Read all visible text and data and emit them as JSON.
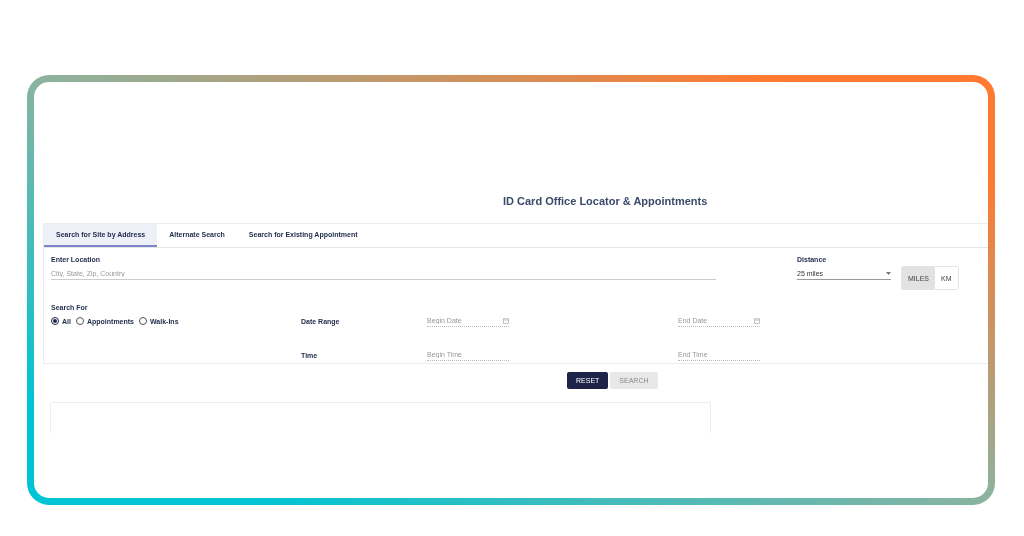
{
  "title": "ID Card Office Locator & Appointments",
  "tabs": [
    {
      "label": "Search for Site by Address",
      "selected": true
    },
    {
      "label": "Alternate Search",
      "selected": false
    },
    {
      "label": "Search for Existing Appointment",
      "selected": false
    }
  ],
  "location": {
    "label": "Enter Location",
    "placeholder": "City, State, Zip, Country"
  },
  "distance": {
    "label": "Distance",
    "value": "25 miles"
  },
  "units": [
    {
      "label": "MILES",
      "selected": true
    },
    {
      "label": "KM",
      "selected": false
    }
  ],
  "search_for": {
    "label": "Search For",
    "options": [
      {
        "label": "All",
        "selected": true
      },
      {
        "label": "Appointments",
        "selected": false
      },
      {
        "label": "Walk-Ins",
        "selected": false
      }
    ]
  },
  "date_range": {
    "label": "Date Range",
    "begin_placeholder": "Begin Date",
    "end_placeholder": "End Date"
  },
  "time": {
    "label": "Time",
    "begin_placeholder": "Begin Time",
    "end_placeholder": "End Time"
  },
  "buttons": [
    {
      "label": "RESET",
      "disabled": false
    },
    {
      "label": "SEARCH",
      "disabled": true
    }
  ]
}
